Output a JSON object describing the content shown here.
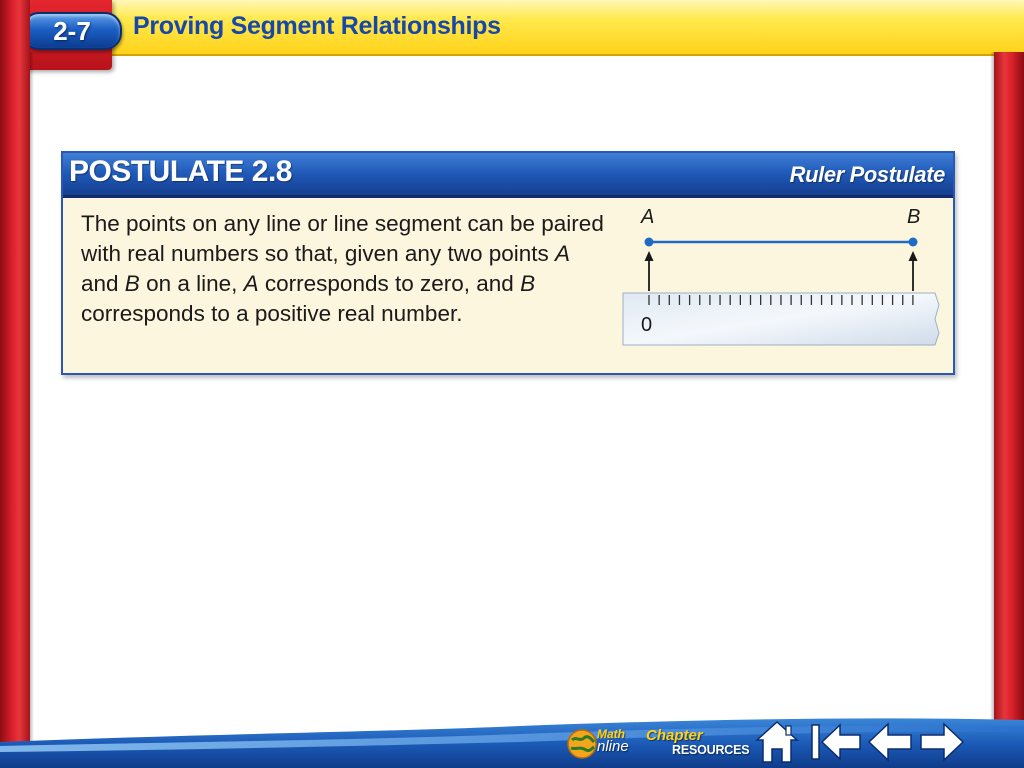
{
  "lesson": {
    "number": "2-7",
    "title": "Proving Segment Relationships"
  },
  "postulate": {
    "label": "POSTULATE 2.8",
    "name": "Ruler Postulate",
    "text_parts": [
      "The points on any line or line segment can be paired with real numbers so that, given any two points ",
      "A",
      " and ",
      "B",
      " on a line, ",
      "A",
      " corresponds to zero, and ",
      "B",
      " corresponds to a positive real number."
    ],
    "figure": {
      "point_a": "A",
      "point_b": "B",
      "ruler_zero": "0"
    }
  },
  "nav": {
    "math_label": "Math",
    "online_label": "nline",
    "chapter_label": "Chapter",
    "resources_label": "RESOURCES",
    "icons": [
      "home-icon",
      "first-slide-icon",
      "previous-slide-icon",
      "next-slide-icon"
    ]
  },
  "colors": {
    "frame_red": "#d8202a",
    "title_yellow": "#ffe94d",
    "title_blue": "#1747a8",
    "postulate_blue": "#1f58b8",
    "postulate_bg": "#fdf6df",
    "nav_blue": "#1c5bb8"
  }
}
